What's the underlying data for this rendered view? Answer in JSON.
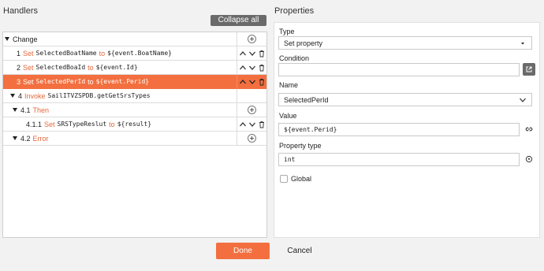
{
  "handlers": {
    "title": "Handlers",
    "collapse_all": "Collapse all",
    "rows": [
      {
        "num": "",
        "kw": "",
        "name": "Change",
        "to": "",
        "value": ""
      },
      {
        "num": "1",
        "kw": "Set",
        "name": "SelectedBoatName",
        "to": "to",
        "value": "${event.BoatName}"
      },
      {
        "num": "2",
        "kw": "Set",
        "name": "SelectedBoaId",
        "to": "to",
        "value": "${event.Id}"
      },
      {
        "num": "3",
        "kw": "Set",
        "name": "SelectedPerId",
        "to": "to",
        "value": "${event.Perid}"
      },
      {
        "num": "4",
        "kw": "Invoke",
        "name": "SailITVZSPDB.getGetSrsTypes",
        "to": "",
        "value": ""
      },
      {
        "num": "4.1",
        "kw": "Then",
        "name": "",
        "to": "",
        "value": ""
      },
      {
        "num": "4.1.1",
        "kw": "Set",
        "name": "SRSTypeReslut",
        "to": "to",
        "value": "${result}"
      },
      {
        "num": "4.2",
        "kw": "Error",
        "name": "",
        "to": "",
        "value": ""
      }
    ]
  },
  "properties": {
    "title": "Properties",
    "type_label": "Type",
    "type_value": "Set property",
    "condition_label": "Condition",
    "condition_value": "",
    "name_label": "Name",
    "name_value": "SelectedPerId",
    "value_label": "Value",
    "value_value": "${event.Perid}",
    "property_type_label": "Property type",
    "property_type_value": "int",
    "global_label": "Global"
  },
  "footer": {
    "done": "Done",
    "cancel": "Cancel"
  },
  "colors": {
    "accent": "#f36f3f",
    "button_gray": "#6a6a6a"
  }
}
